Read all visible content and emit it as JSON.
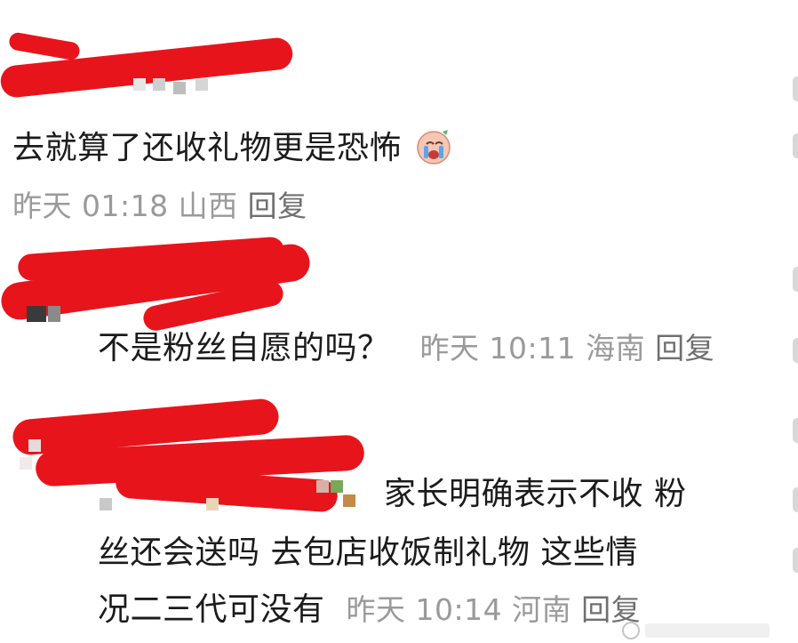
{
  "comments": [
    {
      "text": "去就算了还收礼物更是恐怖",
      "emoji": "crying-face-emoji",
      "time": "昨天 01:18",
      "location": "山西",
      "reply": "回复"
    },
    {
      "text": "不是粉丝自愿的吗？",
      "time": "昨天 10:11",
      "location": "海南",
      "reply": "回复"
    },
    {
      "lines": [
        "家长明确表示不收 粉",
        "丝还会送吗 去包店收饭制礼物 这些情",
        "况二三代可没有"
      ],
      "time": "昨天 10:14",
      "location": "河南",
      "reply": "回复"
    }
  ],
  "colors": {
    "redaction": "#e8141c",
    "meta_text": "#9a9a9a",
    "body_text": "#1b1b1b"
  }
}
